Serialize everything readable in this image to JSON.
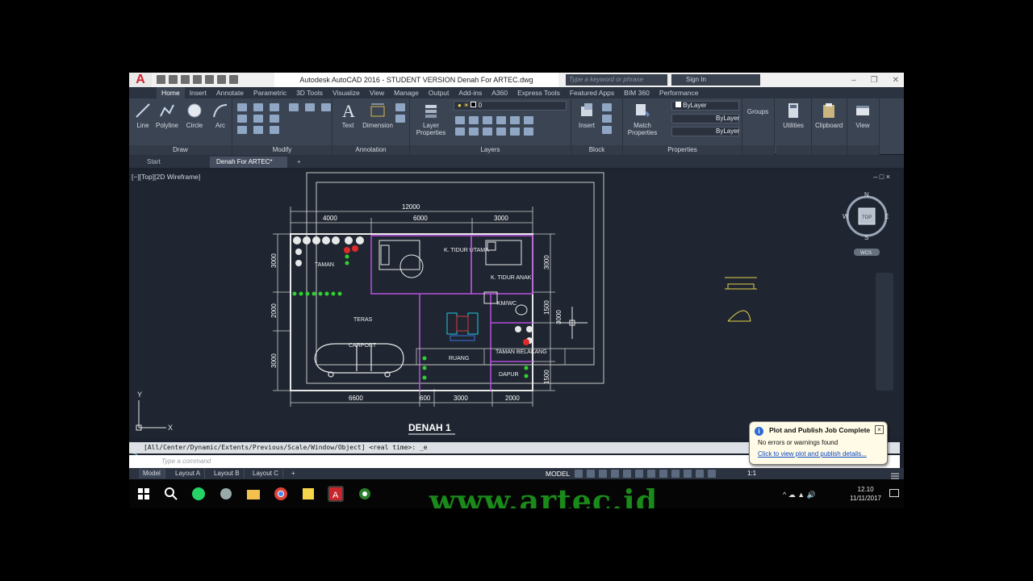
{
  "window": {
    "title": "Autodesk AutoCAD 2016 - STUDENT VERSION    Denah For ARTEC.dwg",
    "search_placeholder": "Type a keyword or phrase",
    "signin": "Sign In"
  },
  "ribbon_tabs": [
    "Home",
    "Insert",
    "Annotate",
    "Parametric",
    "3D Tools",
    "Visualize",
    "View",
    "Manage",
    "Output",
    "Add-ins",
    "A360",
    "Express Tools",
    "Featured Apps",
    "BIM 360",
    "Performance"
  ],
  "ribbon": {
    "draw": {
      "title": "Draw",
      "line": "Line",
      "polyline": "Polyline",
      "circle": "Circle",
      "arc": "Arc"
    },
    "modify": {
      "title": "Modify"
    },
    "annotation": {
      "title": "Annotation",
      "text": "Text",
      "dimension": "Dimension"
    },
    "layers": {
      "title": "Layers",
      "layer_properties": "Layer\nProperties",
      "current_layer": "0"
    },
    "block": {
      "title": "Block",
      "insert": "Insert"
    },
    "properties": {
      "title": "Properties",
      "match": "Match\nProperties",
      "bylayer1": "ByLayer",
      "bylayer2": "ByLayer",
      "bylayer3": "ByLayer"
    },
    "groups": "Groups",
    "utilities": "Utilities",
    "clipboard": "Clipboard",
    "view": "View"
  },
  "file_tabs": {
    "start": "Start",
    "active": "Denah For ARTEC*"
  },
  "viewport": {
    "label": "[−][Top][2D Wireframe]",
    "controls": "–  □  ×",
    "viewcube_top": "TOP",
    "compass": {
      "n": "N",
      "s": "S",
      "e": "E",
      "w": "W"
    },
    "wcs": "WCS"
  },
  "plan": {
    "title": "DENAH 1",
    "dims_top": {
      "total": "12000",
      "a": "4000",
      "b": "6000",
      "c": "3000"
    },
    "dims_bottom": {
      "a": "6600",
      "b": "600",
      "c": "3000",
      "d": "2000"
    },
    "dims_left": {
      "a": "3000",
      "b": "2000",
      "c": "3000"
    },
    "dims_right": {
      "a": "3000",
      "b": "1500",
      "c": "3000",
      "d": "1500"
    },
    "rooms": {
      "taman": "TAMAN",
      "ktidur_utama": "K. TIDUR\nUTAMA",
      "ktidur_anak": "K. TIDUR\nANAK",
      "kmwc": "KM/WC",
      "teras": "TERAS",
      "carport": "CARPORT",
      "ruang": "RUANG",
      "taman_belakang": "TAMAN\nBELAKANG",
      "dapur": "DAPUR"
    }
  },
  "ucs": {
    "y": "Y",
    "x": "X"
  },
  "command": {
    "history": "[All/Center/Dynamic/Extents/Previous/Scale/Window/Object] <real time>:  _e",
    "placeholder": "Type a command"
  },
  "layout_tabs": [
    "Model",
    "Layout A",
    "Layout B",
    "Layout C"
  ],
  "status": {
    "model": "MODEL",
    "scale": "1:1"
  },
  "notification": {
    "title": "Plot and Publish Job Complete",
    "body": "No errors or warnings found",
    "link": "Click to view plot and publish details..."
  },
  "taskbar": {
    "time": "12.10",
    "date": "11/11/2017"
  },
  "watermark": "www.artec.id",
  "colors": {
    "accent_green": "#2fd12f",
    "wall": "#e8e8e8",
    "magenta": "#b04fd6"
  }
}
